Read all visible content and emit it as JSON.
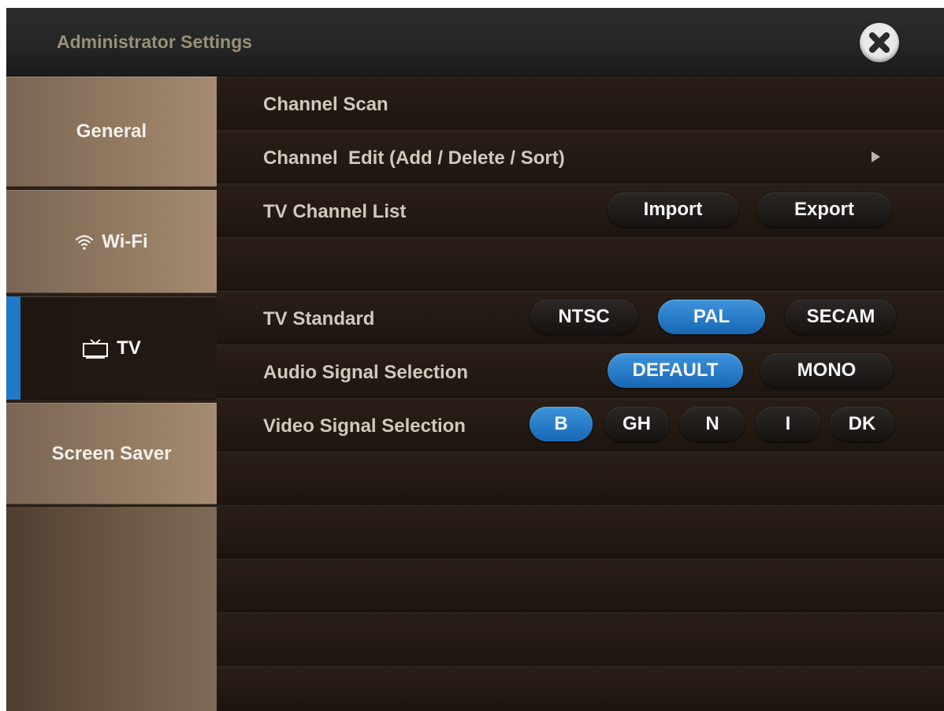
{
  "window": {
    "title": "Administrator Settings",
    "close_icon": "close-icon"
  },
  "sidebar": {
    "items": [
      {
        "label": "General",
        "icon": ""
      },
      {
        "label": "Wi-Fi",
        "icon": "wifi-icon"
      },
      {
        "label": "TV",
        "icon": "tv-icon",
        "active": true
      },
      {
        "label": "Screen Saver",
        "icon": ""
      }
    ]
  },
  "content": {
    "channel_scan": {
      "label": "Channel Scan"
    },
    "channel_edit": {
      "label": "Channel  Edit (Add / Delete / Sort)",
      "icon": "chevron-right-icon"
    },
    "tv_channel_list": {
      "label": "TV Channel List",
      "buttons": [
        "Import",
        "Export"
      ]
    },
    "tv_standard": {
      "label": "TV Standard",
      "options": [
        "NTSC",
        "PAL",
        "SECAM"
      ],
      "selected": "PAL"
    },
    "audio_signal": {
      "label": "Audio Signal Selection",
      "options": [
        "DEFAULT",
        "MONO"
      ],
      "selected": "DEFAULT"
    },
    "video_signal": {
      "label": "Video Signal Selection",
      "options": [
        "B",
        "GH",
        "N",
        "I",
        "DK"
      ],
      "selected": "B"
    }
  },
  "colors": {
    "accent": "#1f79c8",
    "selected_pill": "#2a7ccc",
    "panel": "#1f1712"
  }
}
